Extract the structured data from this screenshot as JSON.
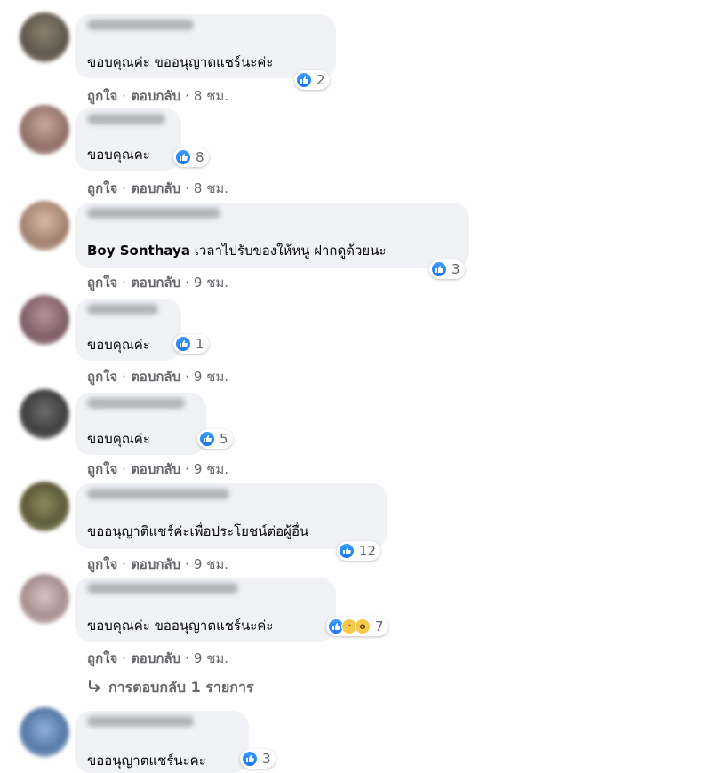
{
  "actions": {
    "like": "ถูกใจ",
    "reply": "ตอบกลับ",
    "separator": "·"
  },
  "comments": [
    {
      "text": "ขอบคุณค่ะ ขออนุญาตแชร์นะค่ะ",
      "reactions": "2",
      "time": "8 ชม."
    },
    {
      "text": "ขอบคุณคะ",
      "reactions": "8",
      "time": "8 ชม."
    },
    {
      "author": "Boy Sonthaya",
      "text": " เวลาไปรับของให้หนู ฝากดูด้วยนะ",
      "reactions": "3",
      "time": "9 ชม."
    },
    {
      "text": "ขอบคุณค่ะ",
      "reactions": "1",
      "time": "9 ชม."
    },
    {
      "text": "ขอบคุณค่ะ",
      "reactions": "5",
      "time": "9 ชม."
    },
    {
      "text": "ขออนุญาติแชร์ค่ะเพื่อประโยชน์ต่อผู้อื่น",
      "reactions": "12",
      "time": "9 ชม."
    },
    {
      "text": "ขอบคุณค่ะ ขออนุญาตแชร์นะค่ะ",
      "reactions": "7",
      "time": "9 ชม."
    },
    {
      "text": "ขออนุญาตแชร์นะคะ",
      "reactions": "3"
    }
  ],
  "view_replies": "การตอบกลับ 1 รายการ",
  "icons": {
    "like": "like-icon",
    "haha": "haha-icon",
    "wow": "wow-icon",
    "reply_arrow": "reply-arrow-icon"
  },
  "colors": {
    "like_blue": "#1877f2",
    "bubble": "#f0f2f5",
    "secondary_text": "#65676b"
  }
}
